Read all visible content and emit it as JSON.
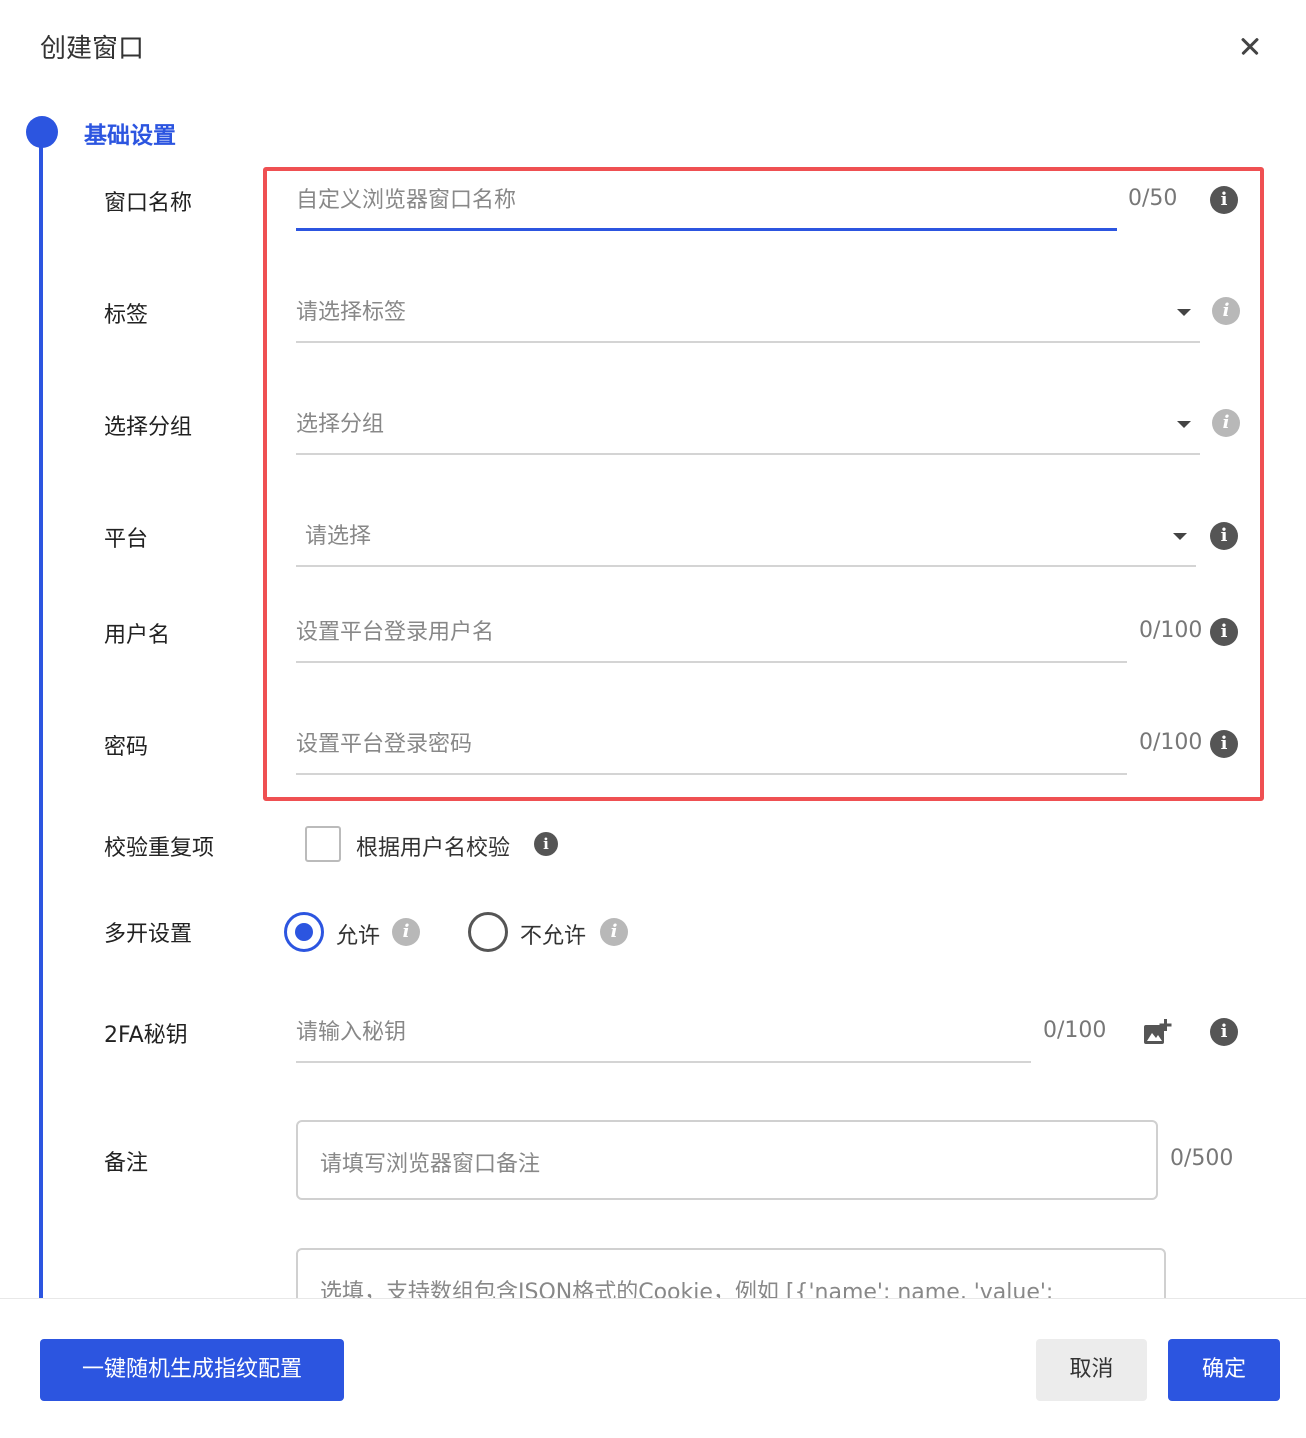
{
  "dialog": {
    "title": "创建窗口"
  },
  "step": {
    "title": "基础设置"
  },
  "fields": {
    "window_name": {
      "label": "窗口名称",
      "placeholder": "自定义浏览器窗口名称",
      "counter": "0/50"
    },
    "tags": {
      "label": "标签",
      "placeholder": "请选择标签"
    },
    "group": {
      "label": "选择分组",
      "placeholder": "选择分组"
    },
    "platform": {
      "label": "平台",
      "placeholder": "请选择"
    },
    "username": {
      "label": "用户名",
      "placeholder": "设置平台登录用户名",
      "counter": "0/100"
    },
    "password": {
      "label": "密码",
      "placeholder": "设置平台登录密码",
      "counter": "0/100"
    },
    "dedupe": {
      "label": "校验重复项",
      "checkbox_label": "根据用户名校验"
    },
    "multi_open": {
      "label": "多开设置",
      "options": [
        "允许",
        "不允许"
      ],
      "selected": "允许"
    },
    "twofa": {
      "label": "2FA秘钥",
      "placeholder": "请输入秘钥",
      "counter": "0/100"
    },
    "remark": {
      "label": "备注",
      "placeholder": "请填写浏览器窗口备注",
      "counter": "0/500"
    },
    "cookie": {
      "placeholder": "选填，支持数组包含JSON格式的Cookie，例如 [{'name': name, 'value':"
    }
  },
  "footer": {
    "random_button": "一键随机生成指纹配置",
    "cancel_button": "取消",
    "confirm_button": "确定"
  },
  "icons": {
    "info": "i",
    "info_glyph_name": "info-icon",
    "image_add": "image-add-icon",
    "close": "close-icon"
  },
  "colors": {
    "accent": "#2c55e0",
    "highlight": "#ef5052"
  }
}
